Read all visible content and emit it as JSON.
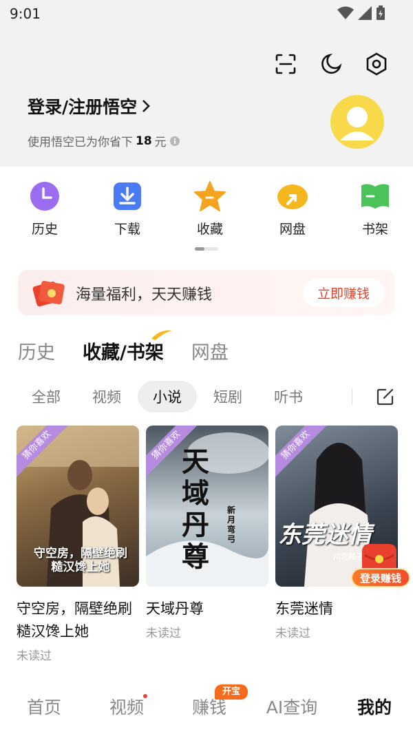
{
  "status_bar": {
    "time": "9:01"
  },
  "header": {
    "login_title": "登录/注册悟空",
    "saved_prefix": "使用悟空已为你省下",
    "saved_amount": "18",
    "saved_unit": "元"
  },
  "quick_actions": [
    {
      "label": "历史",
      "icon": "clock-icon",
      "color": "#9b6bf0"
    },
    {
      "label": "下载",
      "icon": "download-icon",
      "color": "#4a7bf5"
    },
    {
      "label": "收藏",
      "icon": "star-icon",
      "color": "#f5a41e"
    },
    {
      "label": "网盘",
      "icon": "cloud-icon",
      "color": "#f5b61e"
    },
    {
      "label": "书架",
      "icon": "book-icon",
      "color": "#4cc35a"
    }
  ],
  "banner": {
    "text": "海量福利，天天赚钱",
    "button": "立即赚钱"
  },
  "main_tabs": [
    {
      "label": "历史",
      "active": false
    },
    {
      "label": "收藏/书架",
      "active": true
    },
    {
      "label": "网盘",
      "active": false
    }
  ],
  "sub_tabs": [
    {
      "label": "全部",
      "active": false
    },
    {
      "label": "视频",
      "active": false
    },
    {
      "label": "小说",
      "active": true
    },
    {
      "label": "短剧",
      "active": false
    },
    {
      "label": "听书",
      "active": false
    }
  ],
  "books": [
    {
      "tag": "猜你喜欢",
      "cover_text": "守空房，隔壁绝刷糙汉馋上她",
      "title": "守空房，隔壁绝刷糙汉馋上她",
      "status": "未读过"
    },
    {
      "tag": "猜你喜欢",
      "cover_text": "天域丹尊",
      "cover_author": "新月弯弓",
      "title": "天域丹尊",
      "status": "未读过"
    },
    {
      "tag": "猜你喜欢",
      "cover_text": "东莞迷情",
      "cover_author": "川北耗子著",
      "title": "东莞迷情",
      "status": "未读过"
    }
  ],
  "promo": {
    "login_earn": "登录赚钱"
  },
  "bottom_nav": [
    {
      "label": "首页",
      "active": false
    },
    {
      "label": "视频",
      "active": false
    },
    {
      "label": "赚钱",
      "active": false,
      "badge": "开宝箱"
    },
    {
      "label": "AI查询",
      "active": false
    },
    {
      "label": "我的",
      "active": true
    }
  ],
  "colors": {
    "accent_red": "#e8412d",
    "avatar_yellow": "#f7d94a",
    "tag_purple": "#b58be0"
  }
}
